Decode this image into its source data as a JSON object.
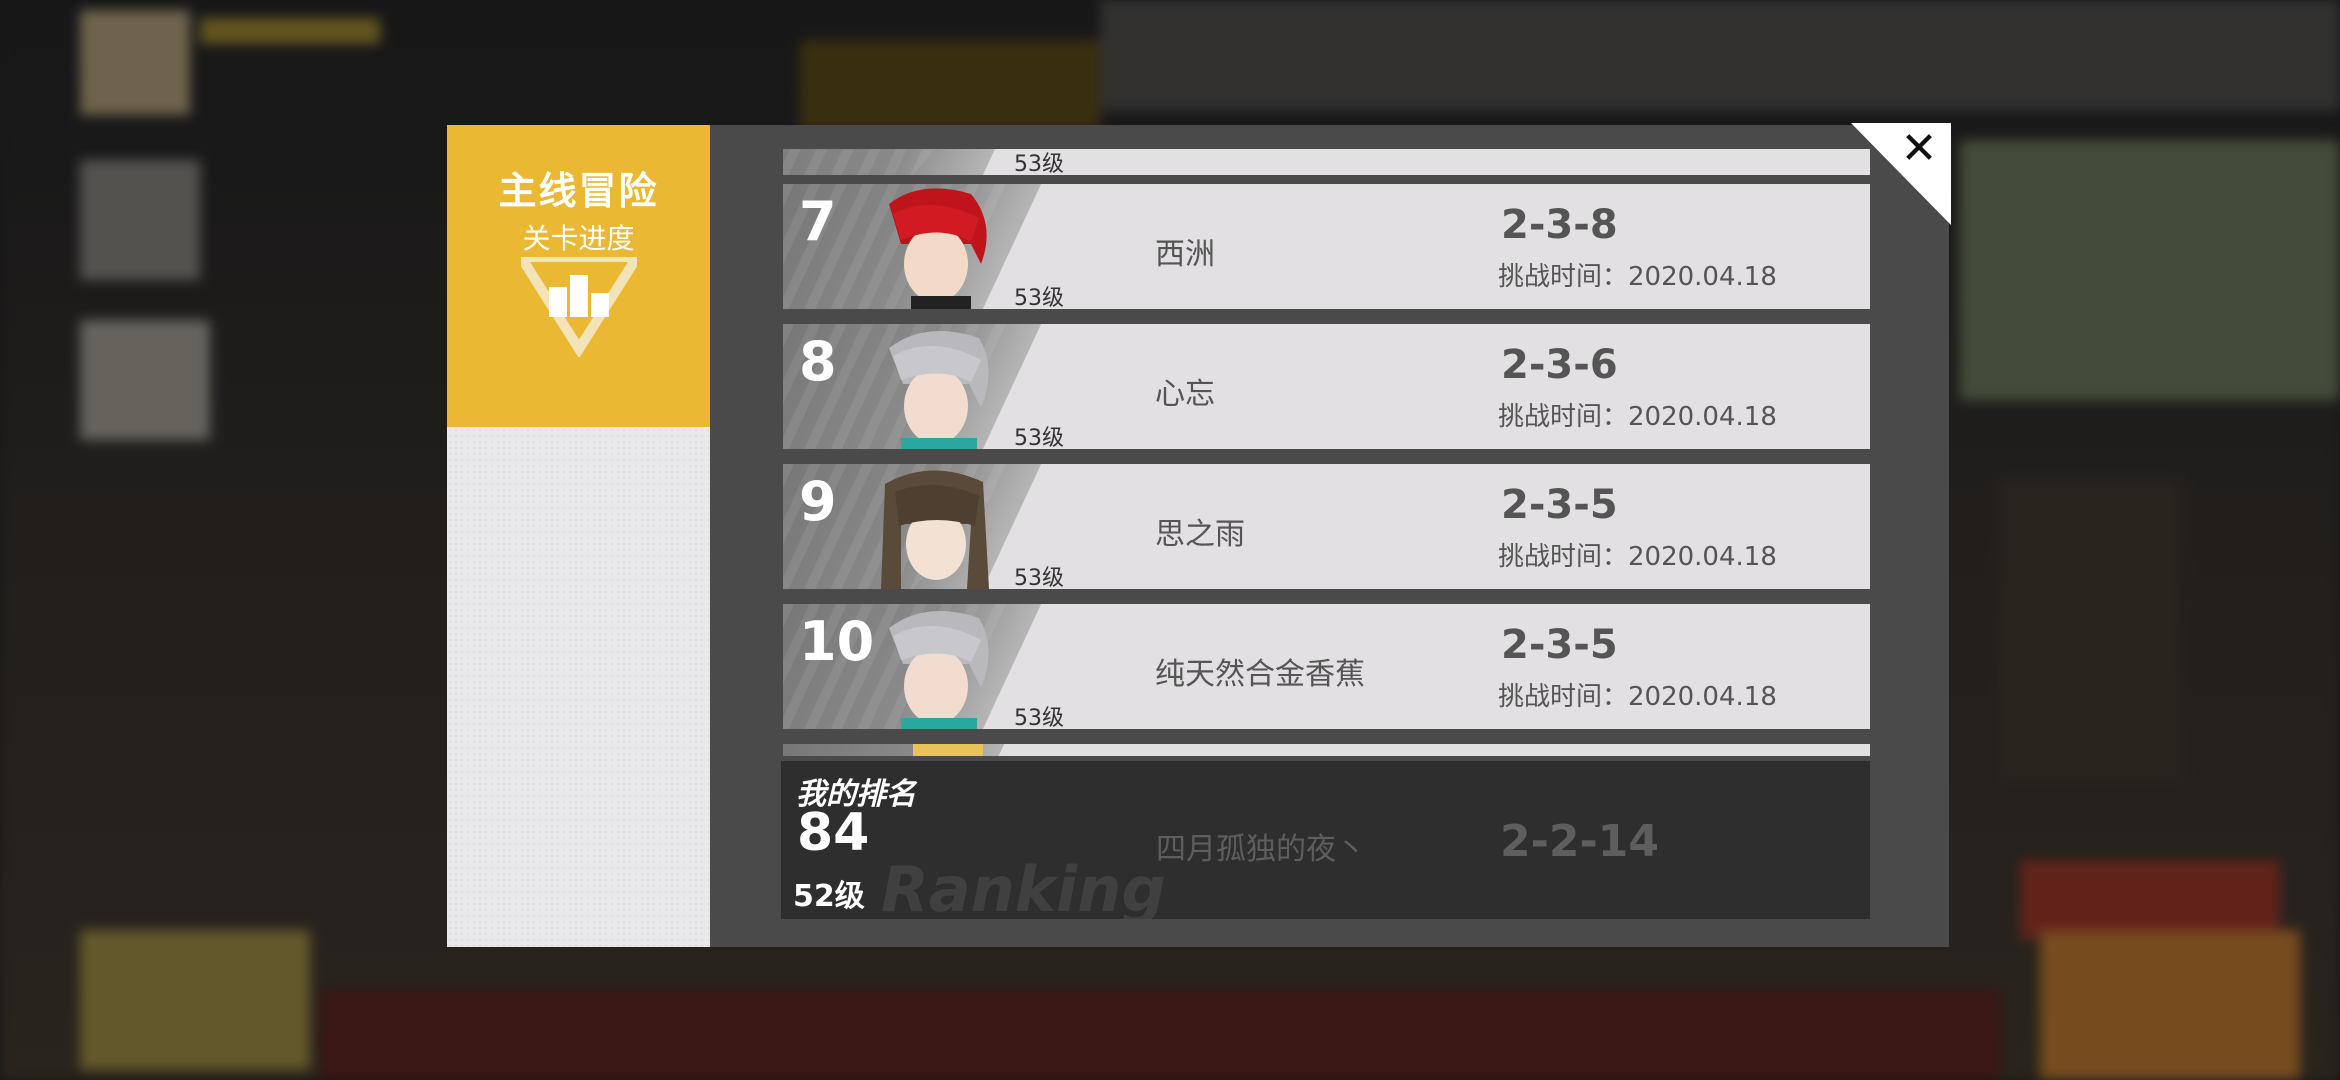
{
  "panel": {
    "tab_title": "主线冒险",
    "tab_subtitle": "关卡进度",
    "close_symbol": "✕"
  },
  "ranking": [
    {
      "rank": "7",
      "name": "西洲",
      "level": "53级",
      "stage": "2-3-8",
      "time": "挑战时间：2020.04.18",
      "hair": "red"
    },
    {
      "rank": "8",
      "name": "心忘",
      "level": "53级",
      "stage": "2-3-6",
      "time": "挑战时间：2020.04.18",
      "hair": "silver"
    },
    {
      "rank": "9",
      "name": "思之雨",
      "level": "53级",
      "stage": "2-3-5",
      "time": "挑战时间：2020.04.18",
      "hair": "brown"
    },
    {
      "rank": "10",
      "name": "纯天然合金香蕉",
      "level": "53级",
      "stage": "2-3-5",
      "time": "挑战时间：2020.04.18",
      "hair": "silver"
    }
  ],
  "partial_rows": {
    "top_level": "53级"
  },
  "my_rank": {
    "label": "我的排名",
    "rank": "84",
    "level": "52级",
    "watermark": "Ranking",
    "name": "四月孤独的夜丶",
    "stage": "2-2-14"
  },
  "colors": {
    "accent": "#ebb834",
    "panel": "#4a4a4a",
    "row": "#e2e0e2",
    "my_rank_bg": "#2e2e2e"
  }
}
